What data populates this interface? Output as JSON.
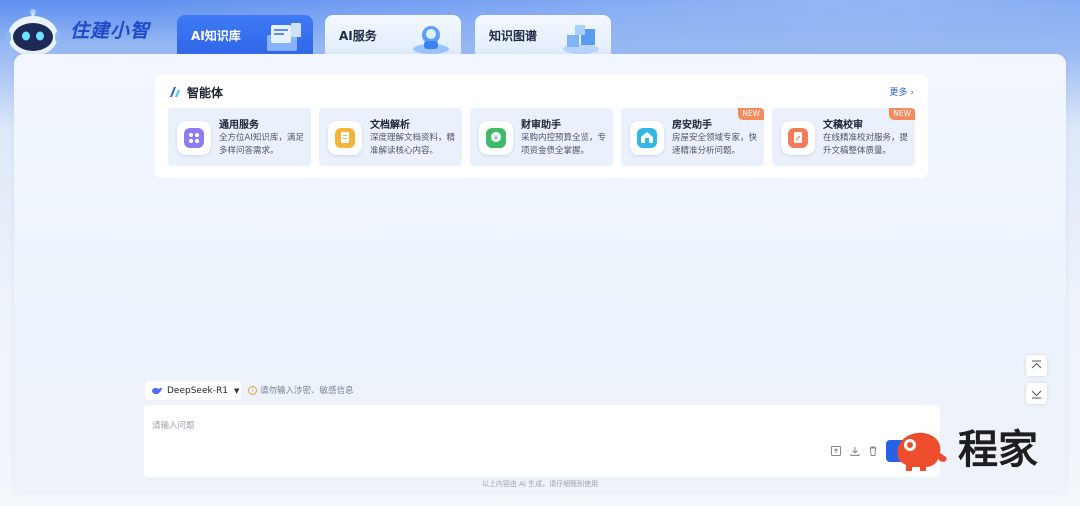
{
  "header": {
    "brand": "住建小智",
    "tabs": [
      {
        "label": "AI知识库",
        "active": true
      },
      {
        "label": "AI服务",
        "active": false
      },
      {
        "label": "知识图谱",
        "active": false
      }
    ]
  },
  "agents": {
    "title": "智能体",
    "more": "更多",
    "items": [
      {
        "title": "通用服务",
        "desc": "全方位AI知识库，满足多样问答需求。",
        "badge": "",
        "icon": "grid-icon",
        "color": "#8e7cf0"
      },
      {
        "title": "文档解析",
        "desc": "深度理解文档资料，精准解读核心内容。",
        "badge": "",
        "icon": "document-icon",
        "color": "#f2b53a"
      },
      {
        "title": "财审助手",
        "desc": "采购内控预算全览，专项资金债全掌握。",
        "badge": "",
        "icon": "finance-icon",
        "color": "#3fba6a"
      },
      {
        "title": "房安助手",
        "desc": "房屋安全领域专家，快速精准分析问题。",
        "badge": "NEW",
        "icon": "house-safety-icon",
        "color": "#35b7e6"
      },
      {
        "title": "文稿校审",
        "desc": "在线精准校对服务，提升文稿整体质量。",
        "badge": "NEW",
        "icon": "proofread-icon",
        "color": "#f27b5a"
      }
    ]
  },
  "model": {
    "selected": "DeepSeek-R1"
  },
  "warning": "请勿输入涉密、敏感信息",
  "input": {
    "placeholder": "请输入问题"
  },
  "footer_note": "以上内容由 AI 生成，请仔细甄别使用",
  "watermark": "程家",
  "colors": {
    "accent": "#2462e8",
    "badge": "#f38b5c"
  }
}
